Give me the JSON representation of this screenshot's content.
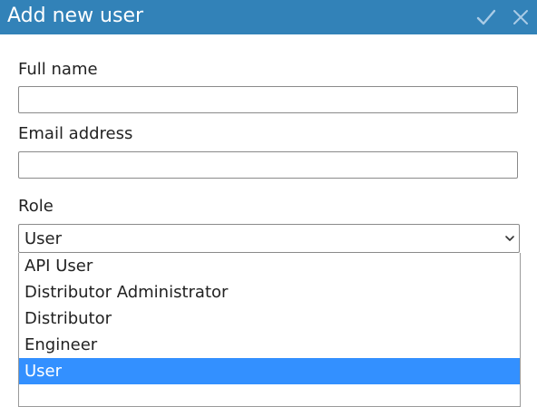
{
  "dialog": {
    "title": "Add new user",
    "confirm_icon": "checkmark-icon",
    "close_icon": "close-icon"
  },
  "form": {
    "full_name": {
      "label": "Full name",
      "value": "",
      "placeholder": ""
    },
    "email": {
      "label": "Email address",
      "value": "",
      "placeholder": ""
    },
    "role": {
      "label": "Role",
      "selected": "User",
      "options": [
        "API User",
        "Distributor Administrator",
        "Distributor",
        "Engineer",
        "User"
      ]
    }
  },
  "colors": {
    "titlebar": "#3282b8",
    "selected_option": "#3390ff"
  }
}
